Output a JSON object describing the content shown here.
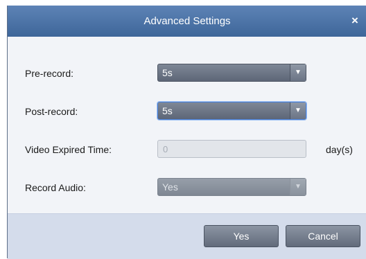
{
  "dialog": {
    "title": "Advanced Settings",
    "close_glyph": "×"
  },
  "fields": {
    "pre_record": {
      "label": "Pre-record:",
      "value": "5s"
    },
    "post_record": {
      "label": "Post-record:",
      "value": "5s"
    },
    "video_expired_time": {
      "label": "Video Expired Time:",
      "placeholder": "0",
      "unit": "day(s)"
    },
    "record_audio": {
      "label": "Record Audio:",
      "value": "Yes"
    }
  },
  "buttons": {
    "yes": "Yes",
    "cancel": "Cancel"
  },
  "icons": {
    "dropdown": "chevron-down-icon",
    "close": "close-icon"
  }
}
